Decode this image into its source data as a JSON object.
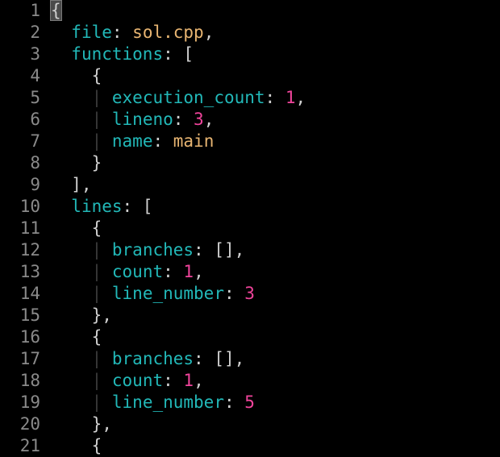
{
  "colors": {
    "background": "#000000",
    "line_number": "#8a8a8a",
    "key": "#22b8b8",
    "string": "#e8b572",
    "number": "#f0449b",
    "punctuation": "#d0d0d0",
    "indent_guide": "#3c3c3c"
  },
  "editor": {
    "cursor_line": 1,
    "lines": [
      {
        "num": "1",
        "tokens": [
          {
            "t": "p",
            "v": "{",
            "cursor": true
          }
        ]
      },
      {
        "num": "2",
        "tokens": [
          {
            "t": "p",
            "v": "  "
          },
          {
            "t": "k",
            "v": "file"
          },
          {
            "t": "p",
            "v": ": "
          },
          {
            "t": "s",
            "v": "sol.cpp"
          },
          {
            "t": "p",
            "v": ","
          }
        ]
      },
      {
        "num": "3",
        "tokens": [
          {
            "t": "p",
            "v": "  "
          },
          {
            "t": "k",
            "v": "functions"
          },
          {
            "t": "p",
            "v": ": ["
          }
        ]
      },
      {
        "num": "4",
        "tokens": [
          {
            "t": "p",
            "v": "    {"
          }
        ]
      },
      {
        "num": "5",
        "tokens": [
          {
            "t": "p",
            "v": "    "
          },
          {
            "t": "g",
            "v": "|"
          },
          {
            "t": "p",
            "v": " "
          },
          {
            "t": "k",
            "v": "execution_count"
          },
          {
            "t": "p",
            "v": ": "
          },
          {
            "t": "n",
            "v": "1"
          },
          {
            "t": "p",
            "v": ","
          }
        ]
      },
      {
        "num": "6",
        "tokens": [
          {
            "t": "p",
            "v": "    "
          },
          {
            "t": "g",
            "v": "|"
          },
          {
            "t": "p",
            "v": " "
          },
          {
            "t": "k",
            "v": "lineno"
          },
          {
            "t": "p",
            "v": ": "
          },
          {
            "t": "n",
            "v": "3"
          },
          {
            "t": "p",
            "v": ","
          }
        ]
      },
      {
        "num": "7",
        "tokens": [
          {
            "t": "p",
            "v": "    "
          },
          {
            "t": "g",
            "v": "|"
          },
          {
            "t": "p",
            "v": " "
          },
          {
            "t": "k",
            "v": "name"
          },
          {
            "t": "p",
            "v": ": "
          },
          {
            "t": "s",
            "v": "main"
          }
        ]
      },
      {
        "num": "8",
        "tokens": [
          {
            "t": "p",
            "v": "    }"
          }
        ]
      },
      {
        "num": "9",
        "tokens": [
          {
            "t": "p",
            "v": "  ],"
          }
        ]
      },
      {
        "num": "10",
        "tokens": [
          {
            "t": "p",
            "v": "  "
          },
          {
            "t": "k",
            "v": "lines"
          },
          {
            "t": "p",
            "v": ": ["
          }
        ]
      },
      {
        "num": "11",
        "tokens": [
          {
            "t": "p",
            "v": "    {"
          }
        ]
      },
      {
        "num": "12",
        "tokens": [
          {
            "t": "p",
            "v": "    "
          },
          {
            "t": "g",
            "v": "|"
          },
          {
            "t": "p",
            "v": " "
          },
          {
            "t": "k",
            "v": "branches"
          },
          {
            "t": "p",
            "v": ": [],"
          }
        ]
      },
      {
        "num": "13",
        "tokens": [
          {
            "t": "p",
            "v": "    "
          },
          {
            "t": "g",
            "v": "|"
          },
          {
            "t": "p",
            "v": " "
          },
          {
            "t": "k",
            "v": "count"
          },
          {
            "t": "p",
            "v": ": "
          },
          {
            "t": "n",
            "v": "1"
          },
          {
            "t": "p",
            "v": ","
          }
        ]
      },
      {
        "num": "14",
        "tokens": [
          {
            "t": "p",
            "v": "    "
          },
          {
            "t": "g",
            "v": "|"
          },
          {
            "t": "p",
            "v": " "
          },
          {
            "t": "k",
            "v": "line_number"
          },
          {
            "t": "p",
            "v": ": "
          },
          {
            "t": "n",
            "v": "3"
          }
        ]
      },
      {
        "num": "15",
        "tokens": [
          {
            "t": "p",
            "v": "    },"
          }
        ]
      },
      {
        "num": "16",
        "tokens": [
          {
            "t": "p",
            "v": "    {"
          }
        ]
      },
      {
        "num": "17",
        "tokens": [
          {
            "t": "p",
            "v": "    "
          },
          {
            "t": "g",
            "v": "|"
          },
          {
            "t": "p",
            "v": " "
          },
          {
            "t": "k",
            "v": "branches"
          },
          {
            "t": "p",
            "v": ": [],"
          }
        ]
      },
      {
        "num": "18",
        "tokens": [
          {
            "t": "p",
            "v": "    "
          },
          {
            "t": "g",
            "v": "|"
          },
          {
            "t": "p",
            "v": " "
          },
          {
            "t": "k",
            "v": "count"
          },
          {
            "t": "p",
            "v": ": "
          },
          {
            "t": "n",
            "v": "1"
          },
          {
            "t": "p",
            "v": ","
          }
        ]
      },
      {
        "num": "19",
        "tokens": [
          {
            "t": "p",
            "v": "    "
          },
          {
            "t": "g",
            "v": "|"
          },
          {
            "t": "p",
            "v": " "
          },
          {
            "t": "k",
            "v": "line_number"
          },
          {
            "t": "p",
            "v": ": "
          },
          {
            "t": "n",
            "v": "5"
          }
        ]
      },
      {
        "num": "20",
        "tokens": [
          {
            "t": "p",
            "v": "    },"
          }
        ]
      },
      {
        "num": "21",
        "tokens": [
          {
            "t": "p",
            "v": "    {"
          }
        ]
      }
    ]
  }
}
